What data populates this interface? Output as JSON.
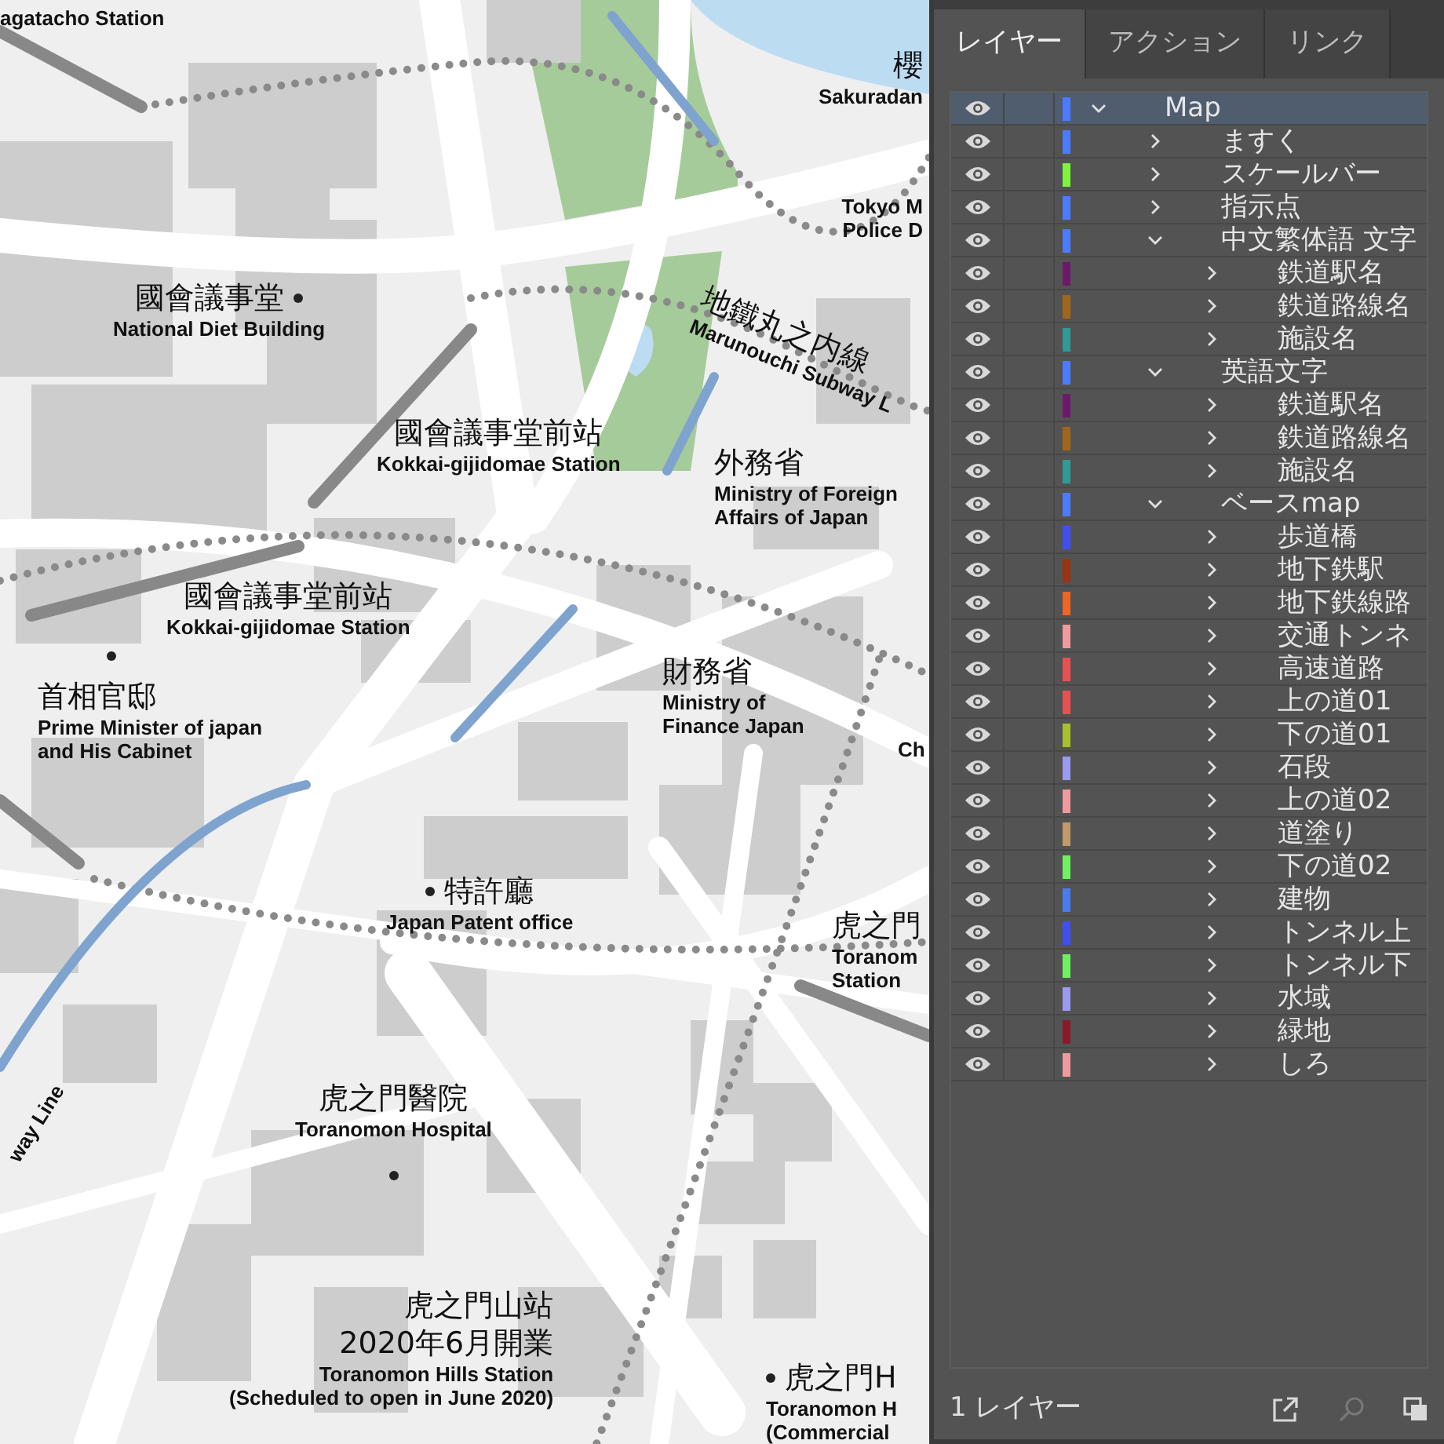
{
  "map": {
    "labels": [
      {
        "en": [
          "agatacho Station"
        ]
      },
      {
        "ja": [
          "國會議事堂"
        ],
        "en": [
          "National Diet Building"
        ],
        "dot": true
      },
      {
        "ja": [
          "國會議事堂前站"
        ],
        "en": [
          "Kokkai-gijidomae Station"
        ]
      },
      {
        "ja": [
          "國會議事堂前站"
        ],
        "en": [
          "Kokkai-gijidomae Station"
        ]
      },
      {
        "ja": [
          "首相官邸"
        ],
        "en": [
          "Prime Minister of japan",
          "and His Cabinet"
        ],
        "dot": true
      },
      {
        "ja": [
          "外務省"
        ],
        "en": [
          "Ministry of Foreign",
          "Affairs of Japan"
        ]
      },
      {
        "ja": [
          "財務省"
        ],
        "en": [
          "Ministry of",
          "Finance Japan"
        ]
      },
      {
        "ja": [
          "特許廳"
        ],
        "en": [
          "Japan Patent office"
        ],
        "dot": true
      },
      {
        "ja": [
          "虎之門醫院"
        ],
        "en": [
          "Toranomon Hospital"
        ],
        "dot": true
      },
      {
        "ja": [
          "虎之門山站",
          "2020年6月開業"
        ],
        "en": [
          "Toranomon Hills Station",
          "(Scheduled to open in June 2020)"
        ]
      },
      {
        "ja": [
          "櫻"
        ],
        "en": [
          "Sakuradan"
        ]
      },
      {
        "en": [
          "Tokyo M",
          "Police D"
        ]
      },
      {
        "ja": [
          "虎之門"
        ],
        "en": [
          "Toranom",
          "Station"
        ]
      },
      {
        "ja": [
          "虎之門H"
        ],
        "en": [
          "Toranomon H",
          "(Commercial"
        ],
        "dot": true
      },
      {
        "en": [
          "Ch"
        ]
      },
      {
        "ja": [
          "地鐵丸之内線"
        ],
        "en": [
          "Marunouchi Subway L"
        ]
      },
      {
        "en": [
          "way Line"
        ]
      }
    ]
  },
  "panel": {
    "tabs": [
      {
        "label": "レイヤー",
        "selected": true
      },
      {
        "label": "アクション",
        "selected": false
      },
      {
        "label": "リンク",
        "selected": false
      }
    ],
    "layers": [
      {
        "name": "Map",
        "color": "#4a7cff",
        "expanded": true,
        "selected": true,
        "children": [
          {
            "name": "ますく",
            "color": "#4a7cff",
            "expanded": false,
            "selected": false
          },
          {
            "name": "スケールバー",
            "color": "#7cf53c",
            "expanded": false,
            "selected": false
          },
          {
            "name": "指示点",
            "color": "#4a7cff",
            "expanded": false,
            "selected": false
          },
          {
            "name": "中文繁体語 文字",
            "color": "#4a7cff",
            "expanded": true,
            "selected": false,
            "children": [
              {
                "name": "鉄道駅名",
                "color": "#6b1a6b",
                "expanded": false,
                "selected": false
              },
              {
                "name": "鉄道路線名",
                "color": "#a0661a",
                "expanded": false,
                "selected": false
              },
              {
                "name": "施設名",
                "color": "#2f9a96",
                "expanded": false,
                "selected": false
              }
            ]
          },
          {
            "name": "英語文字",
            "color": "#4a7cff",
            "expanded": true,
            "selected": false,
            "children": [
              {
                "name": "鉄道駅名",
                "color": "#6b1a6b",
                "expanded": false,
                "selected": false
              },
              {
                "name": "鉄道路線名",
                "color": "#a0661a",
                "expanded": false,
                "selected": false
              },
              {
                "name": "施設名",
                "color": "#2f9a96",
                "expanded": false,
                "selected": false
              }
            ]
          },
          {
            "name": "ベースmap",
            "color": "#4a7cff",
            "expanded": true,
            "selected": false,
            "children": [
              {
                "name": "歩道橋",
                "color": "#4050f0",
                "expanded": false,
                "selected": false
              },
              {
                "name": "地下鉄駅",
                "color": "#993311",
                "expanded": false,
                "selected": false
              },
              {
                "name": "地下鉄線路",
                "color": "#ee6622",
                "expanded": false,
                "selected": false
              },
              {
                "name": "交通トンネ",
                "color": "#f09a9a",
                "expanded": false,
                "selected": false
              },
              {
                "name": "高速道路",
                "color": "#e85050",
                "expanded": false,
                "selected": false
              },
              {
                "name": "上の道01",
                "color": "#e85050",
                "expanded": false,
                "selected": false
              },
              {
                "name": "下の道01",
                "color": "#a8c030",
                "expanded": false,
                "selected": false
              },
              {
                "name": "石段",
                "color": "#9a9af0",
                "expanded": false,
                "selected": false
              },
              {
                "name": "上の道02",
                "color": "#f09a9a",
                "expanded": false,
                "selected": false
              },
              {
                "name": "道塗り",
                "color": "#c09a6a",
                "expanded": false,
                "selected": false
              },
              {
                "name": "下の道02",
                "color": "#70f060",
                "expanded": false,
                "selected": false
              },
              {
                "name": "建物",
                "color": "#4a7cf0",
                "expanded": false,
                "selected": false
              },
              {
                "name": "トンネル上",
                "color": "#4050f0",
                "expanded": false,
                "selected": false
              },
              {
                "name": "トンネル下",
                "color": "#70f060",
                "expanded": false,
                "selected": false
              },
              {
                "name": "水域",
                "color": "#9a9af0",
                "expanded": false,
                "selected": false
              },
              {
                "name": "緑地",
                "color": "#8a1a2a",
                "expanded": false,
                "selected": false
              },
              {
                "name": "しろ",
                "color": "#f09a9a",
                "expanded": false,
                "selected": false
              }
            ]
          }
        ]
      }
    ],
    "footer": "1 レイヤー"
  }
}
